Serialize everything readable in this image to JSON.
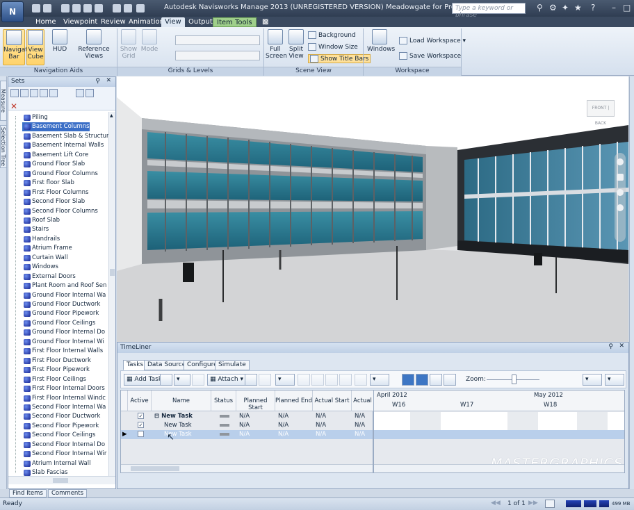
{
  "app": {
    "title": "Autodesk Navisworks Manage 2013 (UNREGISTERED VERSION)   Meadowgate for Project Link.nwd",
    "search_placeholder": "Type a keyword or phrase"
  },
  "menu_tabs": [
    "Home",
    "Viewpoint",
    "Review",
    "Animation",
    "View",
    "Output",
    "Item Tools"
  ],
  "active_tab": "View",
  "ribbon": {
    "navigation_aids": {
      "label": "Navigation Aids",
      "buttons": [
        "Navigation Bar",
        "View Cube",
        "HUD",
        "Reference Views"
      ]
    },
    "grids_levels": {
      "label": "Grids & Levels",
      "buttons": [
        "Show Grid",
        "Mode"
      ]
    },
    "scene_view": {
      "label": "Scene View",
      "buttons": [
        "Full Screen",
        "Split View"
      ],
      "options": [
        "Background",
        "Window Size",
        "Show Title Bars"
      ]
    },
    "workspace": {
      "label": "Workspace",
      "buttons": [
        "Windows"
      ],
      "options": [
        "Load Workspace",
        "Save Workspace"
      ]
    }
  },
  "side_tabs": [
    "Measure Tools",
    "Selection Tree"
  ],
  "sets": {
    "title": "Sets",
    "items": [
      "Piling",
      "Basement Columns",
      "Basement Slab & Structur",
      "Basement Internal Walls",
      "Basement Lift Core",
      "Ground Floor Slab",
      "Ground Floor Columns",
      "First floor Slab",
      "First Floor Columns",
      "Second Floor Slab",
      "Second Floor Columns",
      "Roof Slab",
      "Stairs",
      "Handrails",
      "Atrium Frame",
      "Curtain Wall",
      "Windows",
      "External Doors",
      "Plant Room and Roof Sen",
      "Ground Floor Internal Wa",
      "Ground Floor Ductwork",
      "Ground Floor Pipework",
      "Ground Floor Ceilings",
      "Ground Floor Internal Do",
      "Ground Floor Internal Wi",
      "First Floor Internal Walls",
      "First Floor Ductwork",
      "First Floor Pipework",
      "First Floor Ceilings",
      "First Floor Internal Doors",
      "First Floor Internal Windc",
      "Second Floor Internal Wa",
      "Second Floor Ductwork",
      "Second Floor Pipework",
      "Second Floor Ceilings",
      "Second Floor Internal Do",
      "Second Floor Internal Wir",
      "Atrium Internal Wall",
      "Slab Fascias"
    ],
    "selected": "Basement Columns"
  },
  "bottom_tabs": [
    "Find Items",
    "Comments"
  ],
  "viewcube": {
    "front": "FRONT",
    "back": "BACK"
  },
  "timeliner": {
    "title": "TimeLiner",
    "tabs": [
      "Tasks",
      "Data Sources",
      "Configure",
      "Simulate"
    ],
    "active_tab": "Tasks",
    "toolbar": {
      "add_task": "Add Task",
      "attach": "Attach",
      "zoom": "Zoom:"
    },
    "columns": [
      "Active",
      "Name",
      "Status",
      "Planned Start",
      "Planned End",
      "Actual Start",
      "Actual"
    ],
    "rows": [
      {
        "active": true,
        "name": "New Task",
        "planned_start": "N/A",
        "planned_end": "N/A",
        "actual_start": "N/A",
        "actual": "N/A"
      },
      {
        "active": true,
        "name": "New Task",
        "planned_start": "N/A",
        "planned_end": "N/A",
        "actual_start": "N/A",
        "actual": "N/A"
      },
      {
        "active": true,
        "name": "New Task",
        "planned_start": "N/A",
        "planned_end": "N/A",
        "actual_start": "N/A",
        "actual": "N/A"
      }
    ],
    "gantt": {
      "months": [
        "April 2012",
        "May 2012"
      ],
      "weeks": [
        "W16",
        "W17",
        "W18"
      ]
    }
  },
  "watermark": "MASTERGRAPHICS",
  "status": {
    "text": "Ready",
    "page": "1 of 1",
    "memory": "499 MB"
  }
}
